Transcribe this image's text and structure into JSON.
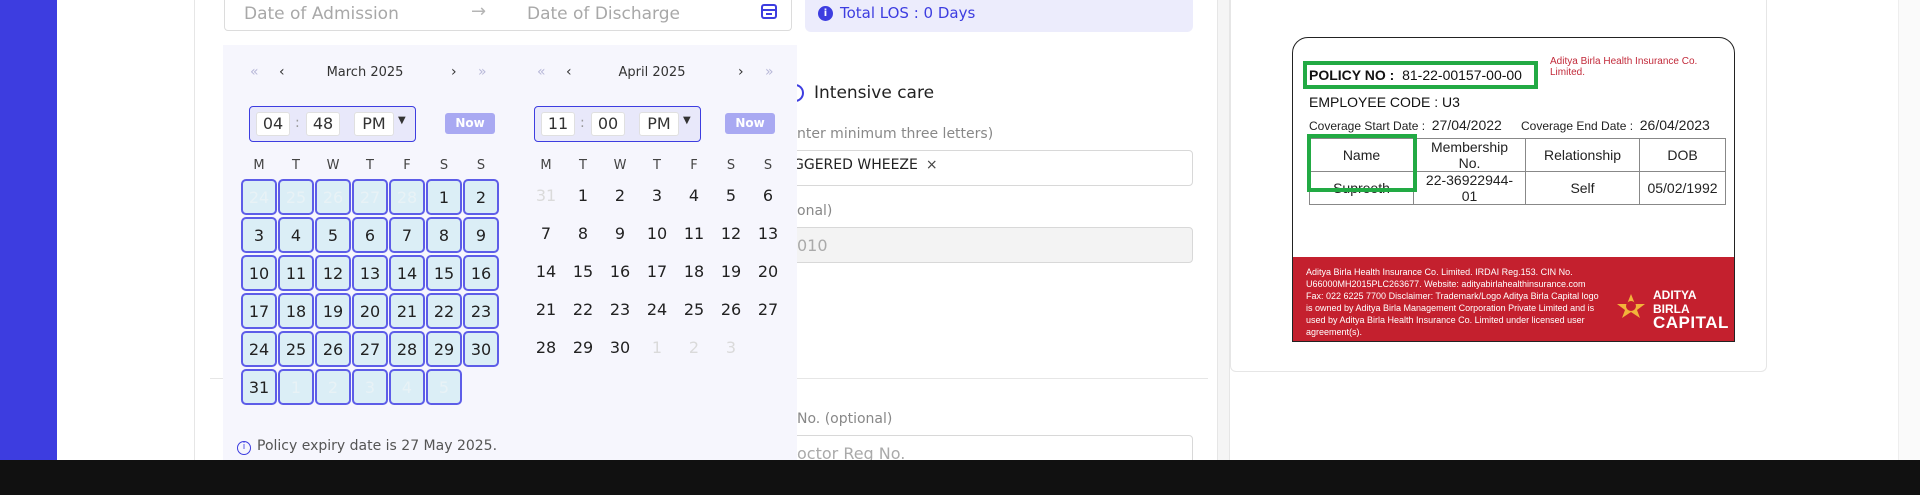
{
  "date_range": {
    "from_placeholder": "Date of Admission",
    "to_placeholder": "Date of Discharge",
    "arrow": "→"
  },
  "los": {
    "icon": "i",
    "text": "Total LOS : 0 Days"
  },
  "background_fields": {
    "intensive_care": "Intensive care",
    "name_hint": "nter minimum three letters)",
    "chip_label": "GGERED WHEEZE",
    "chip_close": "×",
    "optional_label": "onal)",
    "disabled_value": "010",
    "reg_label": "No.",
    "reg_optional": "(optional)",
    "reg_placeholder": "octor Reg No."
  },
  "calendar": {
    "nav": {
      "first": "«",
      "prev": "‹",
      "next": "›",
      "last": "»"
    },
    "now_label": "Now",
    "weekdays": [
      "M",
      "T",
      "W",
      "T",
      "F",
      "S",
      "S"
    ],
    "months": [
      {
        "title": "March 2025",
        "time": {
          "hour": "04",
          "minute": "48",
          "ampm": "PM"
        },
        "days": [
          {
            "d": "24",
            "m": true,
            "s": true
          },
          {
            "d": "25",
            "m": true,
            "s": true
          },
          {
            "d": "26",
            "m": true,
            "s": true
          },
          {
            "d": "27",
            "m": true,
            "s": true
          },
          {
            "d": "28",
            "m": true,
            "s": true
          },
          {
            "d": "1",
            "m": false,
            "s": true
          },
          {
            "d": "2",
            "m": false,
            "s": true
          },
          {
            "d": "3",
            "m": false,
            "s": true
          },
          {
            "d": "4",
            "m": false,
            "s": true
          },
          {
            "d": "5",
            "m": false,
            "s": true
          },
          {
            "d": "6",
            "m": false,
            "s": true
          },
          {
            "d": "7",
            "m": false,
            "s": true
          },
          {
            "d": "8",
            "m": false,
            "s": true
          },
          {
            "d": "9",
            "m": false,
            "s": true
          },
          {
            "d": "10",
            "m": false,
            "s": true
          },
          {
            "d": "11",
            "m": false,
            "s": true
          },
          {
            "d": "12",
            "m": false,
            "s": true
          },
          {
            "d": "13",
            "m": false,
            "s": true
          },
          {
            "d": "14",
            "m": false,
            "s": true
          },
          {
            "d": "15",
            "m": false,
            "s": true
          },
          {
            "d": "16",
            "m": false,
            "s": true
          },
          {
            "d": "17",
            "m": false,
            "s": true
          },
          {
            "d": "18",
            "m": false,
            "s": true
          },
          {
            "d": "19",
            "m": false,
            "s": true
          },
          {
            "d": "20",
            "m": false,
            "s": true
          },
          {
            "d": "21",
            "m": false,
            "s": true
          },
          {
            "d": "22",
            "m": false,
            "s": true
          },
          {
            "d": "23",
            "m": false,
            "s": true
          },
          {
            "d": "24",
            "m": false,
            "s": true
          },
          {
            "d": "25",
            "m": false,
            "s": true
          },
          {
            "d": "26",
            "m": false,
            "s": true
          },
          {
            "d": "27",
            "m": false,
            "s": true
          },
          {
            "d": "28",
            "m": false,
            "s": true
          },
          {
            "d": "29",
            "m": false,
            "s": true
          },
          {
            "d": "30",
            "m": false,
            "s": true
          },
          {
            "d": "31",
            "m": false,
            "s": true
          },
          {
            "d": "1",
            "m": true,
            "s": true
          },
          {
            "d": "2",
            "m": true,
            "s": true
          },
          {
            "d": "3",
            "m": true,
            "s": true
          },
          {
            "d": "4",
            "m": true,
            "s": true
          },
          {
            "d": "5",
            "m": true,
            "s": true
          }
        ]
      },
      {
        "title": "April 2025",
        "time": {
          "hour": "11",
          "minute": "00",
          "ampm": "PM"
        },
        "days": [
          {
            "d": "31",
            "m": true,
            "s": false
          },
          {
            "d": "1",
            "m": false,
            "s": false
          },
          {
            "d": "2",
            "m": false,
            "s": false
          },
          {
            "d": "3",
            "m": false,
            "s": false
          },
          {
            "d": "4",
            "m": false,
            "s": false
          },
          {
            "d": "5",
            "m": false,
            "s": false
          },
          {
            "d": "6",
            "m": false,
            "s": false
          },
          {
            "d": "7",
            "m": false,
            "s": false
          },
          {
            "d": "8",
            "m": false,
            "s": false
          },
          {
            "d": "9",
            "m": false,
            "s": false
          },
          {
            "d": "10",
            "m": false,
            "s": false
          },
          {
            "d": "11",
            "m": false,
            "s": false
          },
          {
            "d": "12",
            "m": false,
            "s": false
          },
          {
            "d": "13",
            "m": false,
            "s": false
          },
          {
            "d": "14",
            "m": false,
            "s": false
          },
          {
            "d": "15",
            "m": false,
            "s": false
          },
          {
            "d": "16",
            "m": false,
            "s": false
          },
          {
            "d": "17",
            "m": false,
            "s": false
          },
          {
            "d": "18",
            "m": false,
            "s": false
          },
          {
            "d": "19",
            "m": false,
            "s": false
          },
          {
            "d": "20",
            "m": false,
            "s": false
          },
          {
            "d": "21",
            "m": false,
            "s": false
          },
          {
            "d": "22",
            "m": false,
            "s": false
          },
          {
            "d": "23",
            "m": false,
            "s": false
          },
          {
            "d": "24",
            "m": false,
            "s": false
          },
          {
            "d": "25",
            "m": false,
            "s": false
          },
          {
            "d": "26",
            "m": false,
            "s": false
          },
          {
            "d": "27",
            "m": false,
            "s": false
          },
          {
            "d": "28",
            "m": false,
            "s": false
          },
          {
            "d": "29",
            "m": false,
            "s": false
          },
          {
            "d": "30",
            "m": false,
            "s": false
          },
          {
            "d": "1",
            "m": true,
            "s": false
          },
          {
            "d": "2",
            "m": true,
            "s": false
          },
          {
            "d": "3",
            "m": true,
            "s": false
          }
        ]
      }
    ],
    "policy_note": "Policy expiry date is 27 May 2025.",
    "policy_note_icon": "i"
  },
  "insurance_card": {
    "company": "Aditya Birla Health Insurance Co. Limited.",
    "policy_label": "POLICY NO :",
    "policy_no": "81-22-00157-00-00",
    "employee_label": "EMPLOYEE CODE :",
    "employee_code": "U3",
    "coverage_start_label": "Coverage Start Date :",
    "coverage_start": "27/04/2022",
    "coverage_end_label": "Coverage End Date :",
    "coverage_end": "26/04/2023",
    "table_headers": [
      "Name",
      "Membership No.",
      "Relationship",
      "DOB"
    ],
    "table_row": [
      "Supreeth",
      "22-36922944-01",
      "Self",
      "05/02/1992"
    ],
    "disclaimer": "Aditya Birla Health Insurance Co. Limited. IRDAI Reg.153. CIN No. U66000MH2015PLC263677. Website: adityabirlahealthinsurance.com Fax: 022 6225 7700 Disclaimer: Trademark/Logo Aditya Birla Capital logo is owned by Aditya Birla Management Corporation Private Limited and is used by Aditya Birla Health Insurance Co. Limited under licensed user agreement(s).",
    "logo_line1": "ADITYA BIRLA",
    "logo_line2": "CAPITAL",
    "highlight_color": "#22aa44",
    "brand_red": "#c4202e"
  },
  "colors": {
    "accent": "#3d3de0",
    "selected_day_bg": "#dbeef6"
  }
}
